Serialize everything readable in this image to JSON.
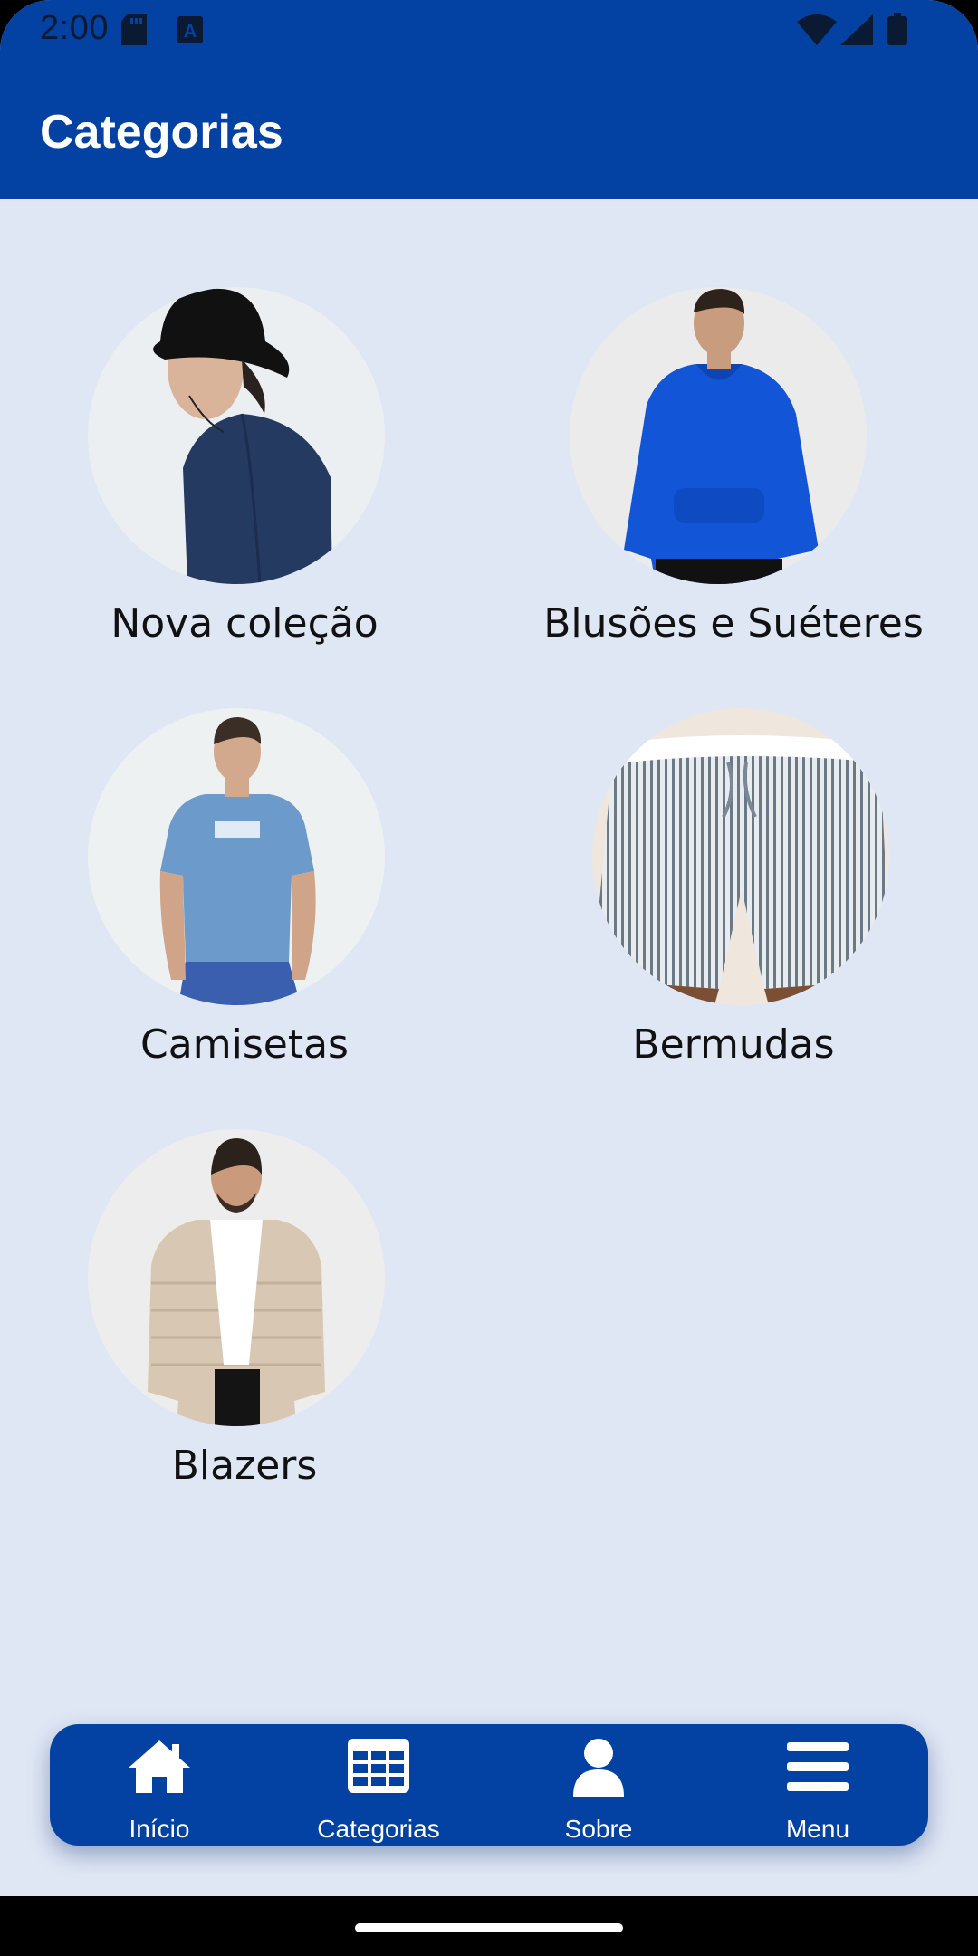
{
  "status_bar": {
    "time": "2:00",
    "icons": [
      "sd-card-icon",
      "a-notification-icon",
      "wifi-icon",
      "signal-icon",
      "battery-icon"
    ]
  },
  "app_bar": {
    "title": "Categorias",
    "color": "#0341A2"
  },
  "categories": [
    {
      "label": "Nova coleção",
      "icon": "model-with-bucket-hat-photo"
    },
    {
      "label": "Blusões e Suéteres",
      "icon": "model-blue-hoodie-photo"
    },
    {
      "label": "Camisetas",
      "icon": "model-light-blue-tshirt-photo"
    },
    {
      "label": "Bermudas",
      "icon": "striped-shorts-photo"
    },
    {
      "label": "Blazers",
      "icon": "model-beige-puffer-jacket-photo"
    }
  ],
  "bottom_nav": {
    "items": [
      {
        "label": "Início",
        "icon": "home-icon"
      },
      {
        "label": "Categorias",
        "icon": "grid-icon"
      },
      {
        "label": "Sobre",
        "icon": "person-icon"
      },
      {
        "label": "Menu",
        "icon": "hamburger-menu-icon"
      }
    ],
    "background": "#0341A2"
  },
  "colors": {
    "page_background": "#DFE6F4",
    "accent": "#0341A2"
  }
}
